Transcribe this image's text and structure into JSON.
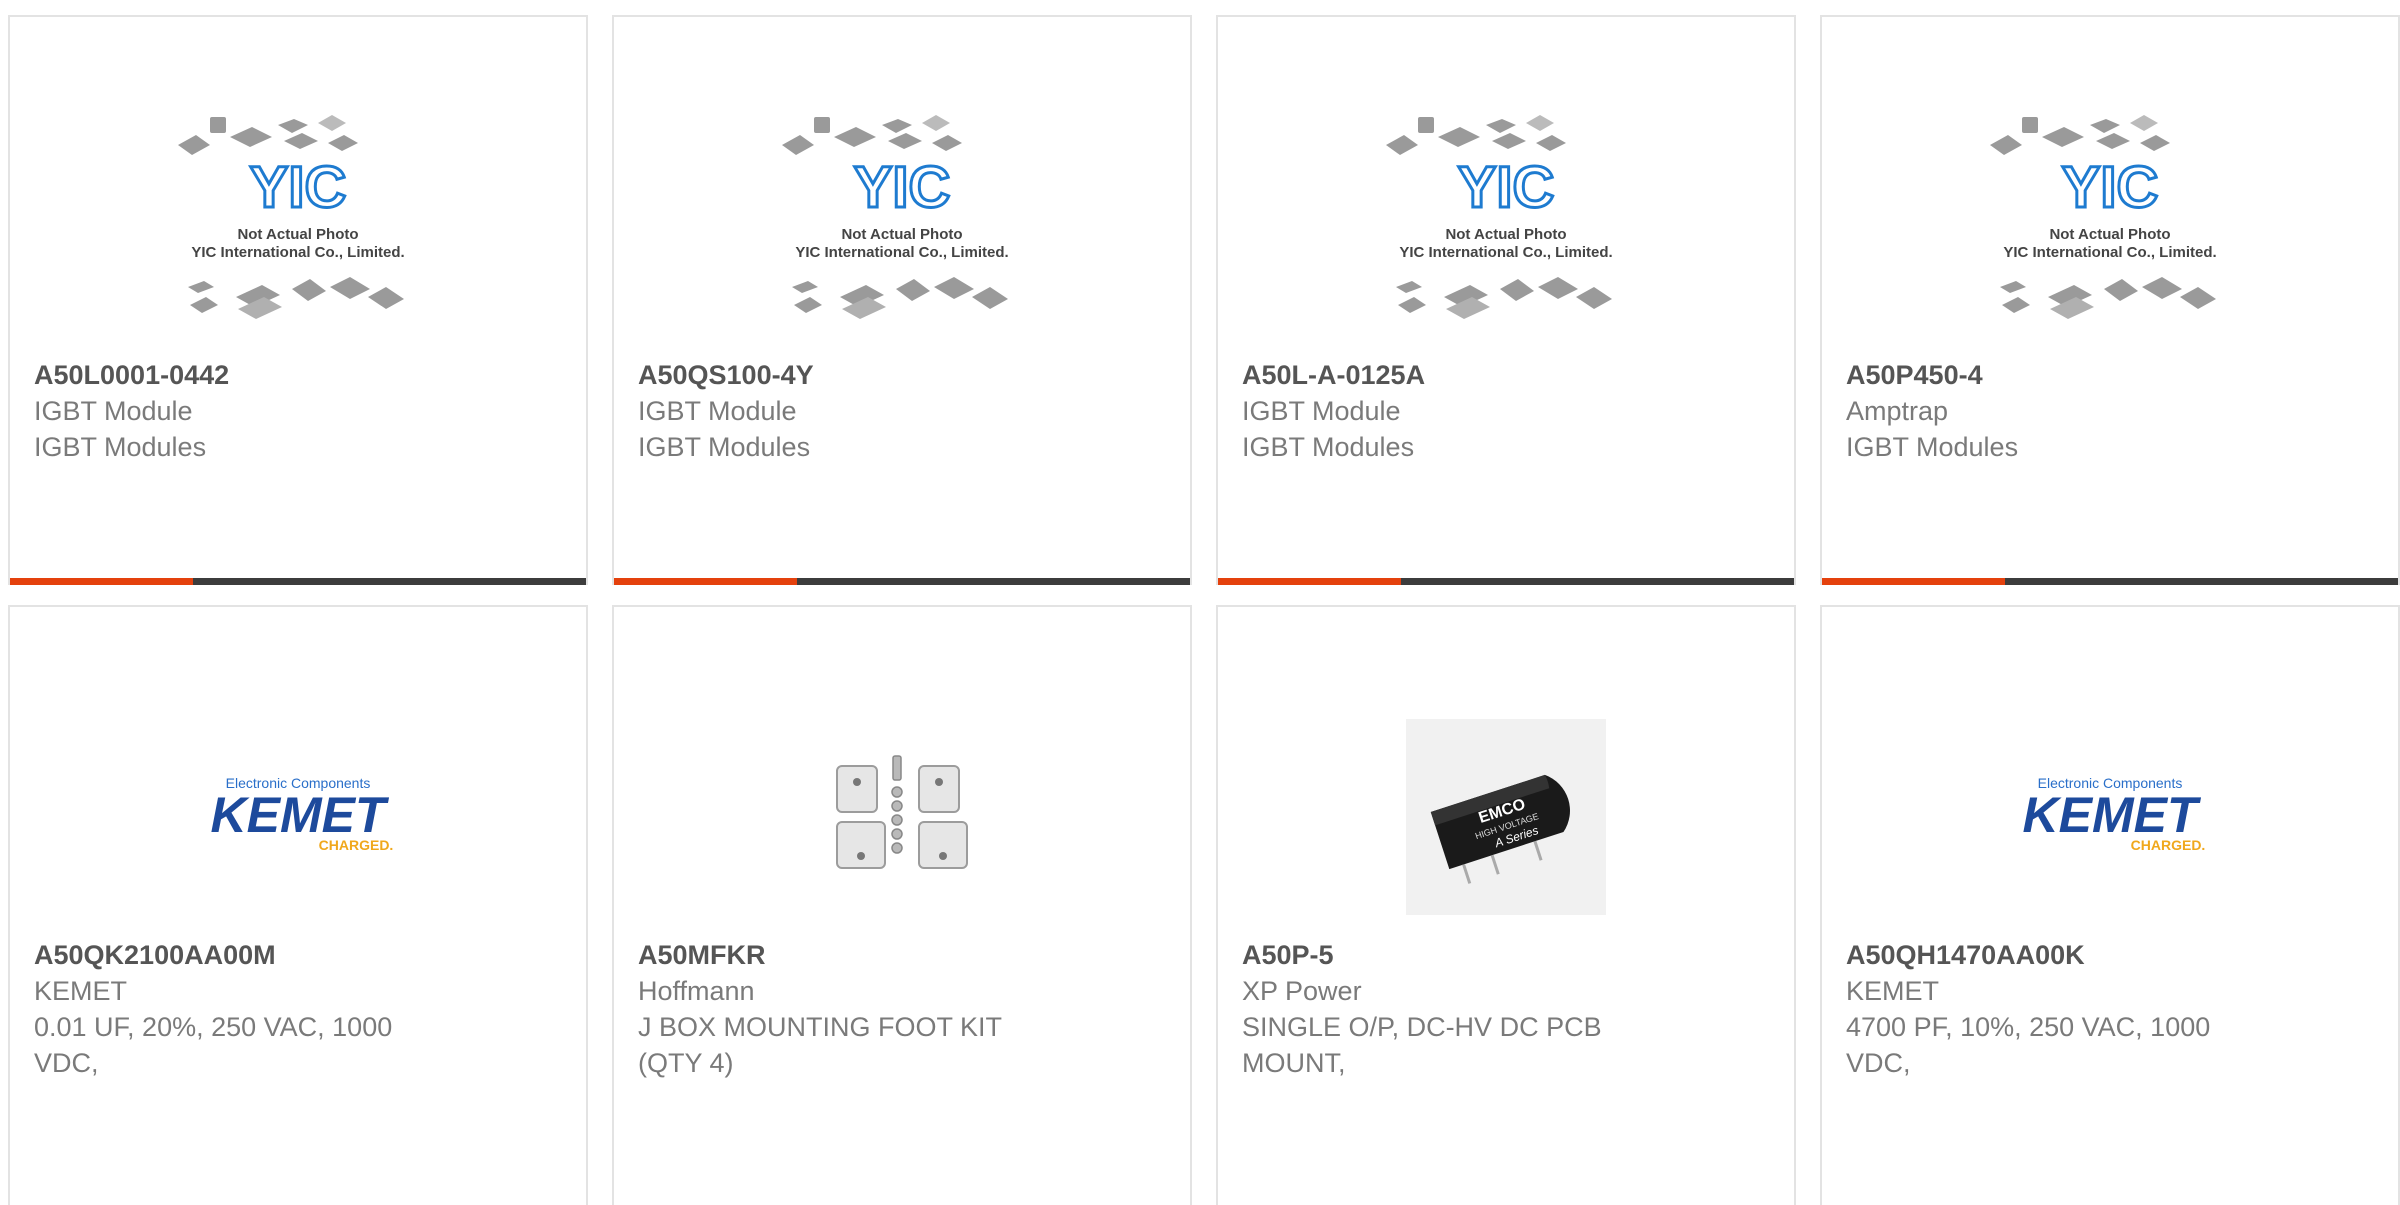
{
  "colors": {
    "accent": "#e4410d",
    "bar": "#3c3c3c",
    "border": "#e3e3e3",
    "yic_blue": "#1e7bd0",
    "kemet_blue": "#1d4a9c",
    "kemet_gold": "#f0a81c"
  },
  "placeholder_image": {
    "brand": "YIC",
    "line1": "Not Actual Photo",
    "line2": "YIC International Co., Limited."
  },
  "kemet_logo": {
    "tagline": "Electronic Components",
    "name": "KEMET",
    "sub": "CHARGED."
  },
  "emco_image": {
    "label1": "EMCO",
    "label2": "HIGH VOLTAGE",
    "label3": "A Series"
  },
  "products": [
    {
      "part": "A50L0001-0442",
      "line1": "IGBT Module",
      "line2": "IGBT Modules",
      "image": "yic-placeholder"
    },
    {
      "part": "A50QS100-4Y",
      "line1": "IGBT Module",
      "line2": "IGBT Modules",
      "image": "yic-placeholder"
    },
    {
      "part": "A50L-A-0125A",
      "line1": "IGBT Module",
      "line2": "IGBT Modules",
      "image": "yic-placeholder"
    },
    {
      "part": "A50P450-4",
      "line1": "Amptrap",
      "line2": "IGBT Modules",
      "image": "yic-placeholder"
    },
    {
      "part": "A50QK2100AA00M",
      "line1": "KEMET",
      "line2": "0.01 UF, 20%, 250 VAC, 1000 VDC,",
      "image": "kemet-logo"
    },
    {
      "part": "A50MFKR",
      "line1": "Hoffmann",
      "line2": "J BOX MOUNTING FOOT KIT (QTY 4)",
      "image": "mounting-kit"
    },
    {
      "part": "A50P-5",
      "line1": "XP Power",
      "line2": "SINGLE O/P, DC-HV DC PCB MOUNT,",
      "image": "emco-module"
    },
    {
      "part": "A50QH1470AA00K",
      "line1": "KEMET",
      "line2": "4700 PF, 10%, 250 VAC, 1000 VDC,",
      "image": "kemet-logo"
    }
  ]
}
